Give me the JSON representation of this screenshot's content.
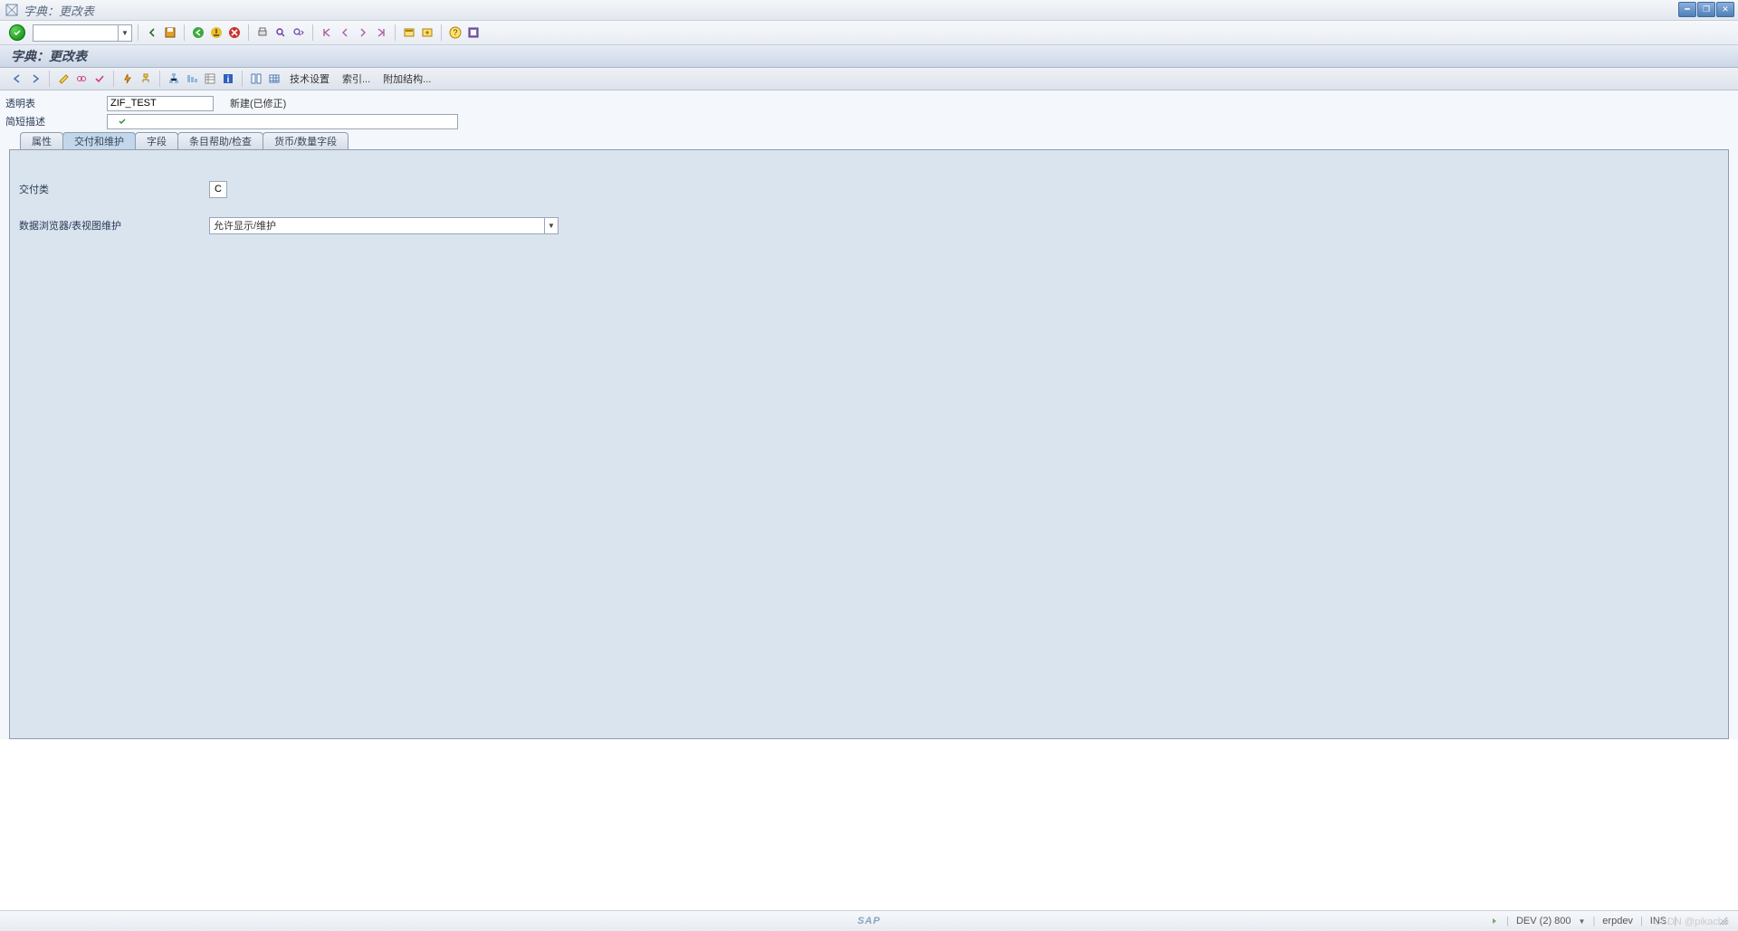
{
  "window": {
    "title": "字典：更改表"
  },
  "subheader": {
    "title": "字典：更改表"
  },
  "toolbar2_text": {
    "tech": "技术设置",
    "index": "索引...",
    "append": "附加结构..."
  },
  "form": {
    "table_label": "透明表",
    "table_value": "ZIF_TEST",
    "status": "新建(已修正)",
    "short_desc_label": "简短描述",
    "short_desc_value": ""
  },
  "tabs": {
    "t1": "属性",
    "t2": "交付和维护",
    "t3": "字段",
    "t4": "条目帮助/检查",
    "t5": "货币/数量字段"
  },
  "panel": {
    "delivery_class_label": "交付类",
    "delivery_class_value": "C",
    "browser_label": "数据浏览器/表视图维护",
    "browser_value": "允许显示/维护"
  },
  "footer": {
    "sap": "SAP",
    "system": "DEV (2) 800",
    "server": "erpdev",
    "ins": "INS"
  },
  "watermark": "CSDN @pikachu"
}
